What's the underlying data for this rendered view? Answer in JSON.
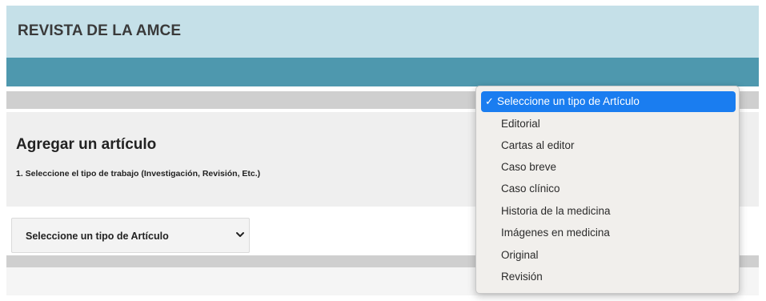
{
  "header": {
    "site_title": "REVISTA DE LA AMCE"
  },
  "colors": {
    "header_bg": "#c5e0e8",
    "nav_bg": "#4e98ae",
    "selected_option_bg": "#1a7df0"
  },
  "main": {
    "section_title": "Agregar un artículo",
    "step_label": "1. Seleccione el tipo de trabajo (Investigación, Revisión, Etc.)"
  },
  "article_type_select": {
    "selected_value": "Seleccione un tipo de Artículo",
    "chevron_icon": "chevron-down-icon",
    "check_icon": "checkmark-icon",
    "options": [
      "Seleccione un tipo de Artículo",
      "Editorial",
      "Cartas al editor",
      "Caso breve",
      "Caso clínico",
      "Historia de la medicina",
      "Imágenes en medicina",
      "Original",
      "Revisión"
    ]
  }
}
